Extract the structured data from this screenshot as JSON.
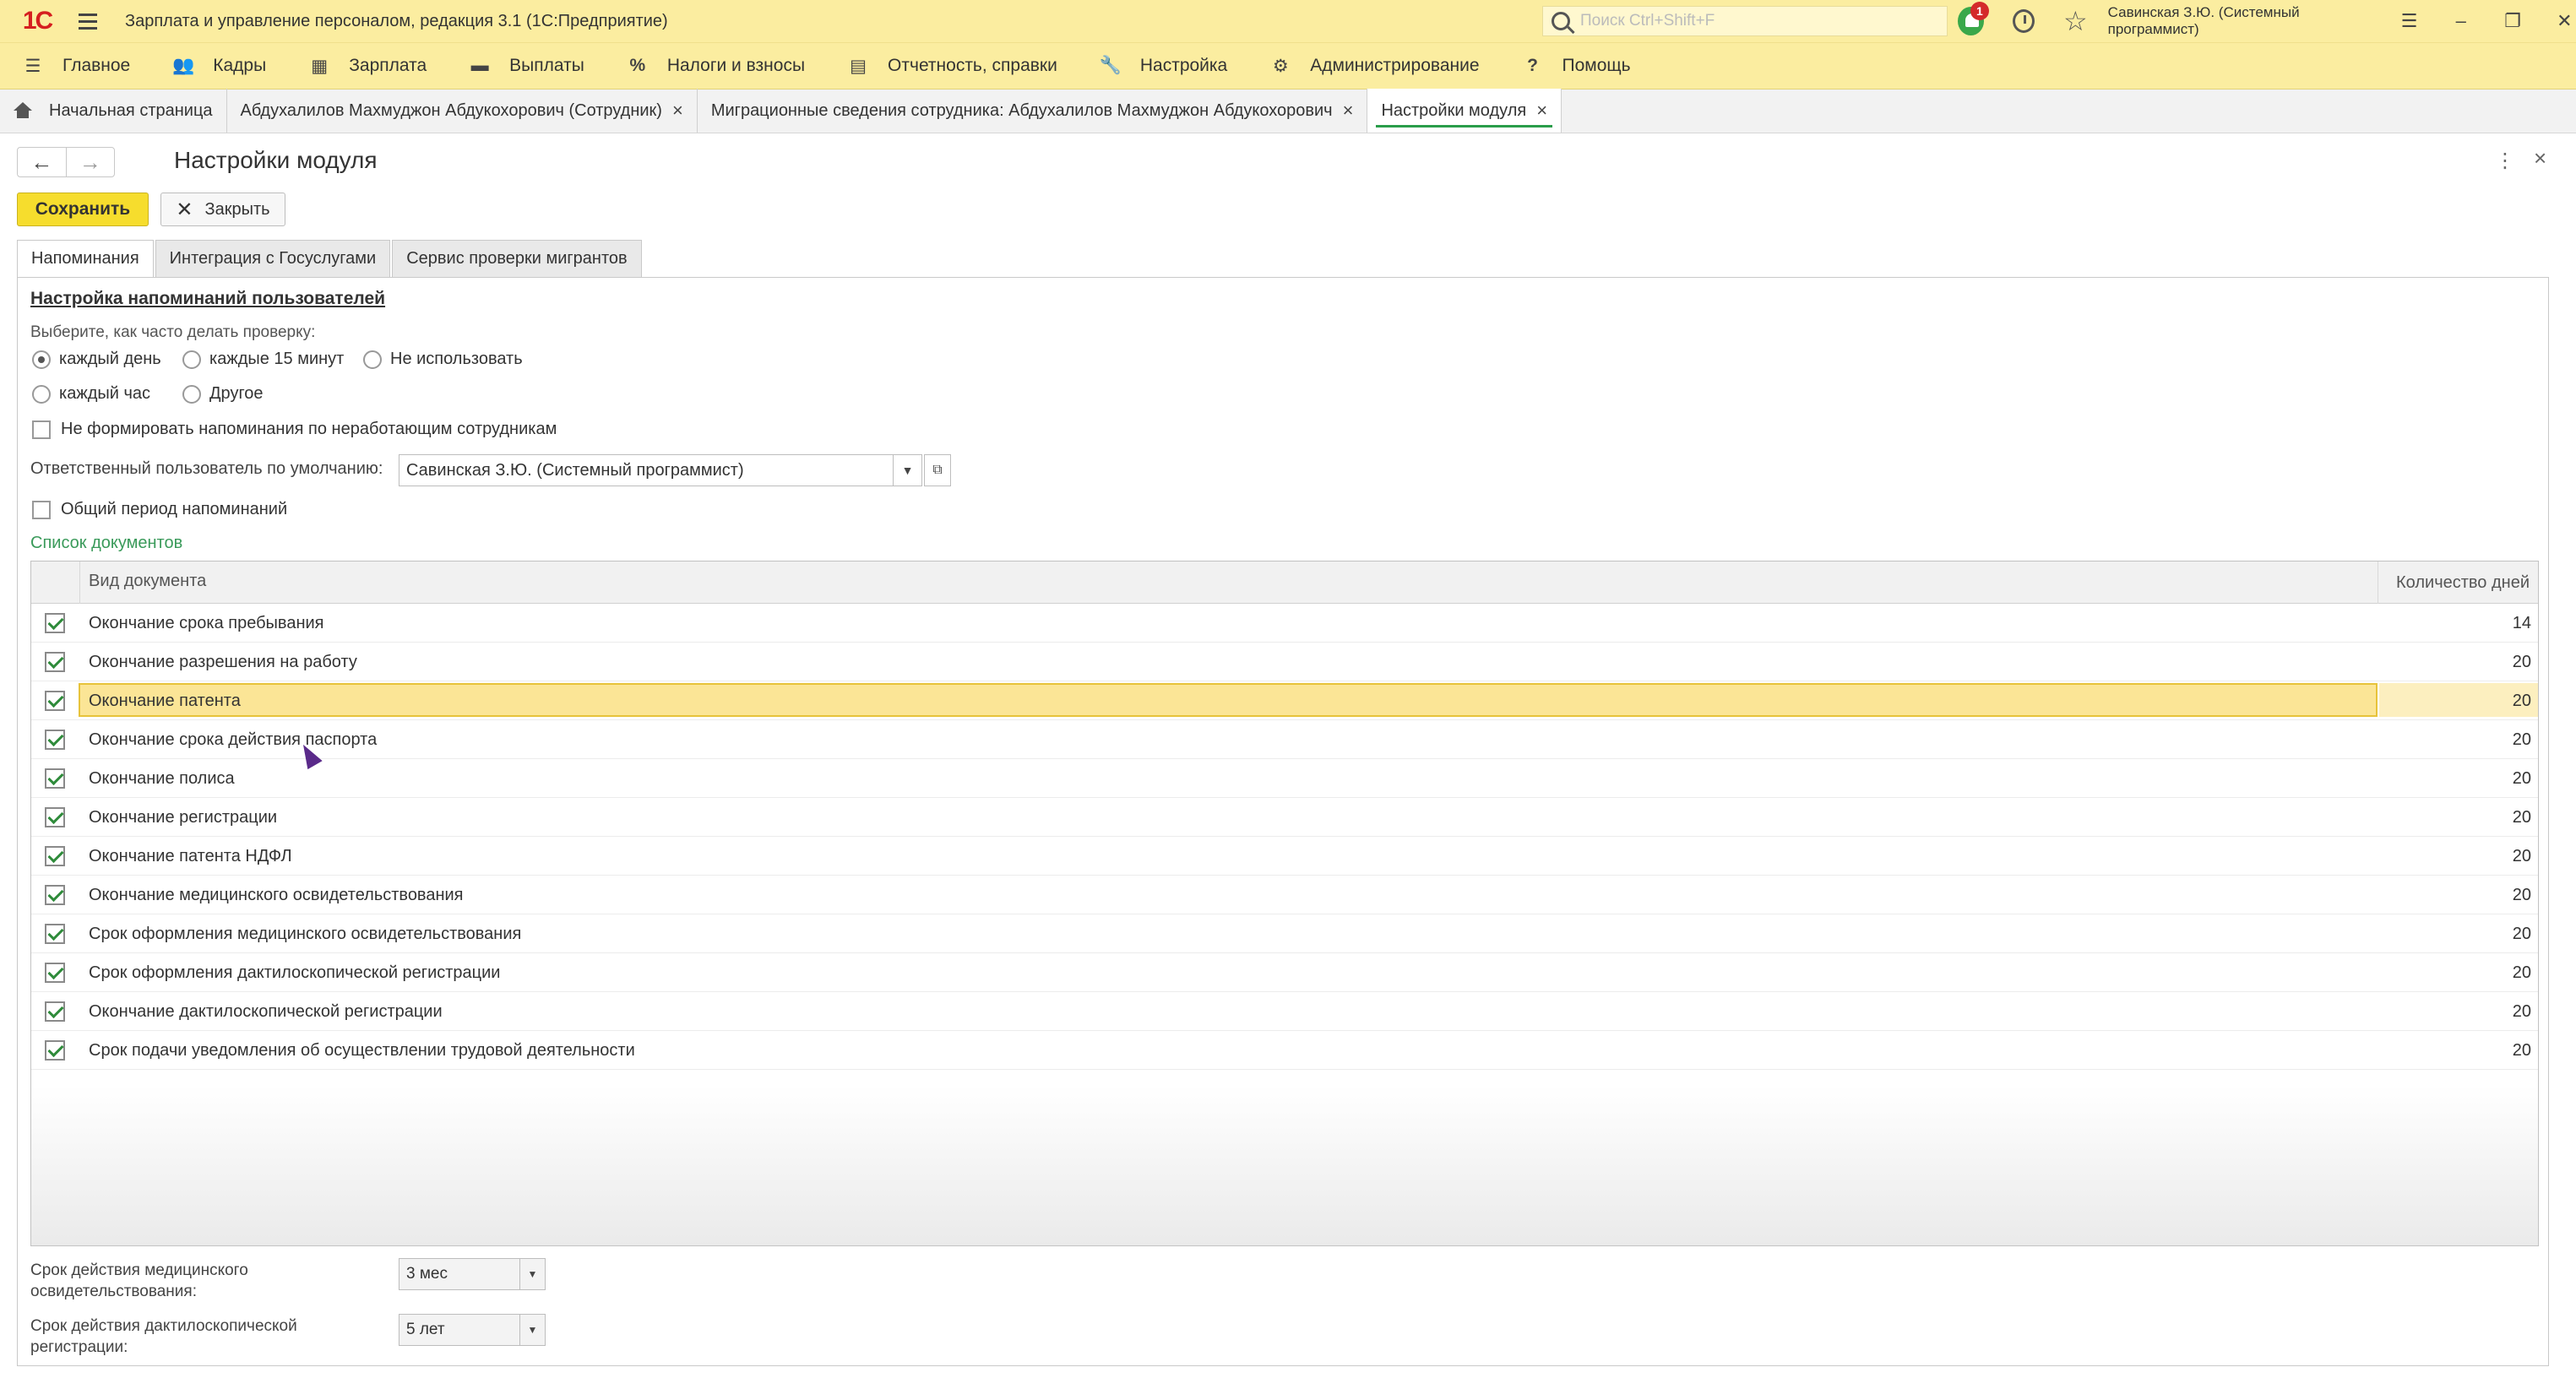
{
  "titlebar": {
    "logo": "1С",
    "title": "Зарплата и управление персоналом, редакция 3.1  (1С:Предприятие)",
    "search_placeholder": "Поиск Ctrl+Shift+F",
    "notification_count": "1",
    "user": "Савинская З.Ю. (Системный программист)"
  },
  "main_menu": [
    {
      "label": "Главное",
      "icon": "menu-icon"
    },
    {
      "label": "Кадры",
      "icon": "people-icon"
    },
    {
      "label": "Зарплата",
      "icon": "calculator-icon"
    },
    {
      "label": "Выплаты",
      "icon": "wallet-icon"
    },
    {
      "label": "Налоги и взносы",
      "icon": "percent-icon"
    },
    {
      "label": "Отчетность, справки",
      "icon": "reports-icon"
    },
    {
      "label": "Настройка",
      "icon": "wrench-icon"
    },
    {
      "label": "Администрирование",
      "icon": "gear-icon"
    },
    {
      "label": "Помощь",
      "icon": "help-icon"
    }
  ],
  "open_tabs": [
    {
      "label": "Начальная страница"
    },
    {
      "label": "Абдухалилов Махмуджон Абдукохорович (Сотрудник)"
    },
    {
      "label": "Миграционные сведения сотрудника: Абдухалилов Махмуджон Абдукохорович"
    },
    {
      "label": "Настройки модуля"
    }
  ],
  "form": {
    "title": "Настройки модуля",
    "save_label": "Сохранить",
    "close_label": "Закрыть"
  },
  "inner_tabs": [
    {
      "label": "Напоминания"
    },
    {
      "label": "Интеграция с Госуслугами"
    },
    {
      "label": "Сервис проверки мигрантов"
    }
  ],
  "reminders": {
    "section_title": "Настройка напоминаний пользователей",
    "frequency_label": "Выберите, как часто делать проверку:",
    "options": {
      "daily": "каждый день",
      "every15": "каждые 15 минут",
      "unused": "Не использовать",
      "hourly": "каждый час",
      "other": "Другое"
    },
    "selected_option": "каждый день",
    "no_reminders_inactive": "Не формировать напоминания по неработающим сотрудникам",
    "responsible_label": "Ответственный пользователь по умолчанию:",
    "responsible_value": "Савинская З.Ю. (Системный программист)",
    "common_period": "Общий период напоминаний",
    "list_title": "Список документов"
  },
  "documents_table": {
    "col_doc": "Вид документа",
    "col_days": "Количество дней",
    "rows": [
      {
        "name": "Окончание срока пребывания",
        "days": "14",
        "checked": true
      },
      {
        "name": "Окончание разрешения на работу",
        "days": "20",
        "checked": true
      },
      {
        "name": "Окончание патента",
        "days": "20",
        "checked": true,
        "selected": true
      },
      {
        "name": "Окончание срока действия паспорта",
        "days": "20",
        "checked": true
      },
      {
        "name": "Окончание полиса",
        "days": "20",
        "checked": true
      },
      {
        "name": "Окончание регистрации",
        "days": "20",
        "checked": true
      },
      {
        "name": "Окончание патента НДФЛ",
        "days": "20",
        "checked": true
      },
      {
        "name": "Окончание медицинского освидетельствования",
        "days": "20",
        "checked": true
      },
      {
        "name": "Срок оформления медицинского освидетельствования",
        "days": "20",
        "checked": true
      },
      {
        "name": "Срок оформления дактилоскопической регистрации",
        "days": "20",
        "checked": true
      },
      {
        "name": "Окончание дактилоскопической регистрации",
        "days": "20",
        "checked": true
      },
      {
        "name": "Срок подачи уведомления об осуществлении трудовой деятельности",
        "days": "20",
        "checked": true
      }
    ]
  },
  "bottom_fields": {
    "med_label": "Срок действия медицинского освидетельствования:",
    "med_value": "3 мес",
    "finger_label": "Срок действия дактилоскопической регистрации:",
    "finger_value": "5 лет"
  }
}
